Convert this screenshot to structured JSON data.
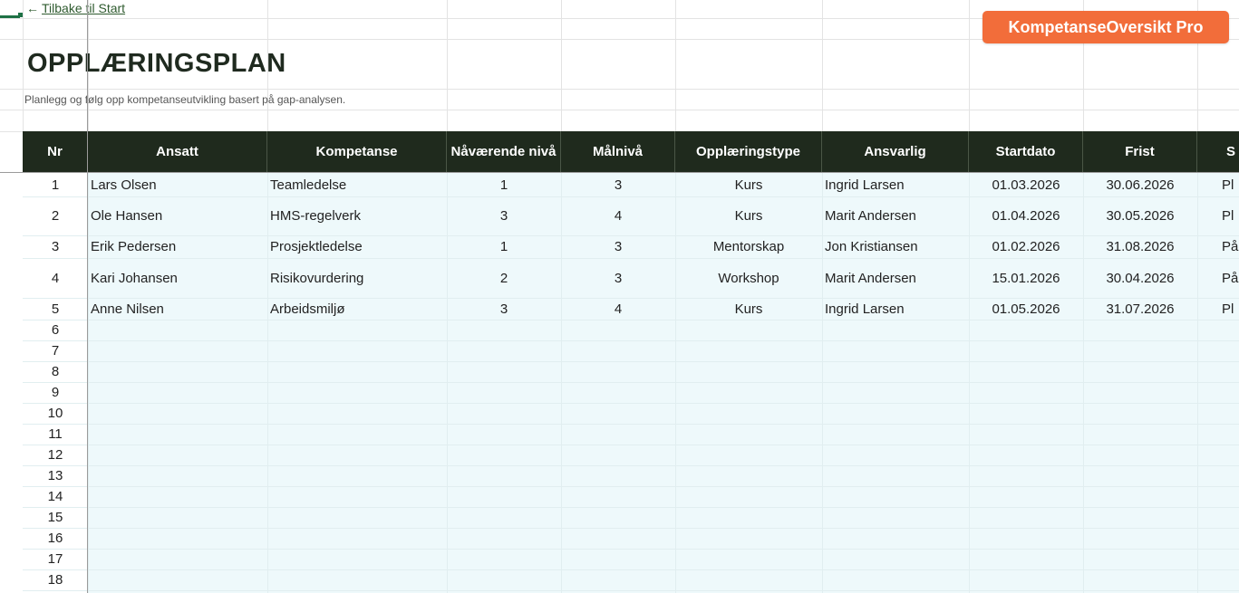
{
  "nav": {
    "back_label": "Tilbake til Start",
    "back_icon": "arrow-left-icon"
  },
  "brand": {
    "label": "KompetanseOversikt Pro",
    "color": "#f26d3a"
  },
  "page": {
    "title": "OPPLÆRINGSPLAN",
    "subtitle": "Planlegg og følg opp kompetanseutvikling basert på gap-analysen."
  },
  "colors": {
    "header_bg": "#1f2a1d",
    "row_bg": "#eef9fb"
  },
  "table": {
    "headers": [
      "Nr",
      "Ansatt",
      "Kompetanse",
      "Nåværende nivå",
      "Målnivå",
      "Opplæringstype",
      "Ansvarlig",
      "Startdato",
      "Frist",
      "S"
    ],
    "rows": [
      [
        "1",
        "Lars Olsen",
        "Teamledelse",
        "1",
        "3",
        "Kurs",
        "Ingrid Larsen",
        "01.03.2026",
        "30.06.2026",
        "Pl"
      ],
      [
        "2",
        "Ole Hansen",
        "HMS-regelverk",
        "3",
        "4",
        "Kurs",
        "Marit Andersen",
        "01.04.2026",
        "30.05.2026",
        "Pl"
      ],
      [
        "3",
        "Erik Pedersen",
        "Prosjektledelse",
        "1",
        "3",
        "Mentorskap",
        "Jon Kristiansen",
        "01.02.2026",
        "31.08.2026",
        "På"
      ],
      [
        "4",
        "Kari Johansen",
        "Risikovurdering",
        "2",
        "3",
        "Workshop",
        "Marit Andersen",
        "15.01.2026",
        "30.04.2026",
        "På"
      ],
      [
        "5",
        "Anne Nilsen",
        "Arbeidsmiljø",
        "3",
        "4",
        "Kurs",
        "Ingrid Larsen",
        "01.05.2026",
        "31.07.2026",
        "Pl"
      ]
    ],
    "empty_row_numbers": [
      "6",
      "7",
      "8",
      "9",
      "10",
      "11",
      "12",
      "13",
      "14",
      "15",
      "16",
      "17",
      "18"
    ]
  }
}
